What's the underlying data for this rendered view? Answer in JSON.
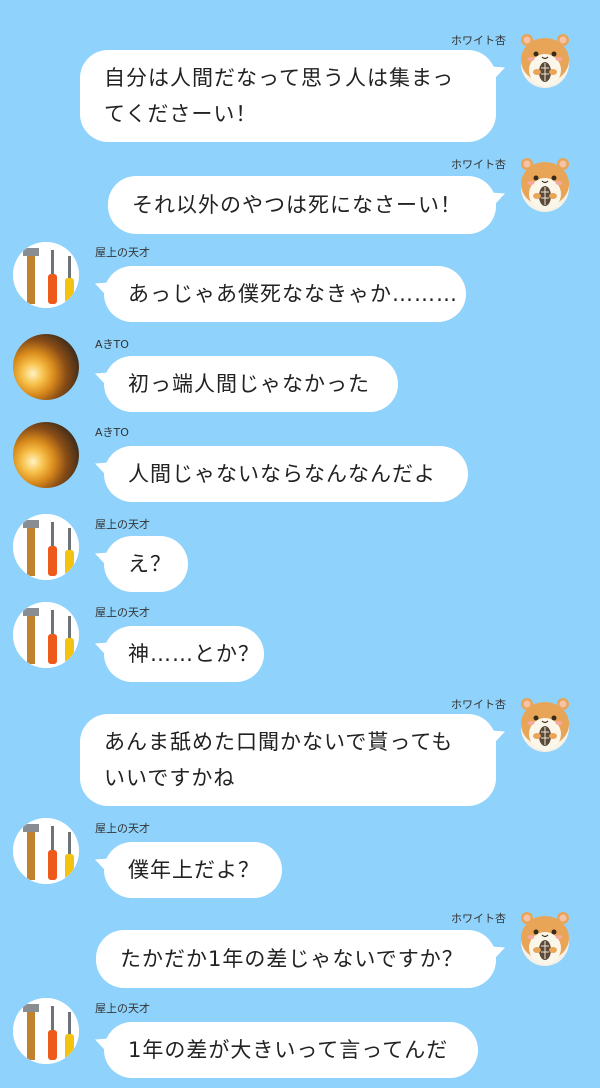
{
  "colors": {
    "background": "#8fd2fb",
    "bubble": "#ffffff",
    "text": "#222222"
  },
  "users": {
    "white_an": "ホワイト杏",
    "rooftop_genius": "屋上の天才",
    "akito": "AきTO"
  },
  "messages": [
    {
      "sender": "ホワイト杏",
      "side": "right",
      "avatar": "hamster-icon",
      "text": [
        "自分は人間だなって思う人は集まっ",
        "てくださーい！"
      ]
    },
    {
      "sender": "ホワイト杏",
      "side": "right",
      "avatar": "hamster-icon",
      "text": [
        "それ以外のやつは死になさーい！"
      ]
    },
    {
      "sender": "屋上の天才",
      "side": "left",
      "avatar": "tools-icon",
      "text": [
        "あっじゃあ僕死ななきゃか………"
      ]
    },
    {
      "sender": "AきTO",
      "side": "left",
      "avatar": "fire-photo-avatar",
      "text": [
        "初っ端人間じゃなかった"
      ]
    },
    {
      "sender": "AきTO",
      "side": "left",
      "avatar": "fire-photo-avatar",
      "text": [
        "人間じゃないならなんなんだよ"
      ]
    },
    {
      "sender": "屋上の天才",
      "side": "left",
      "avatar": "tools-icon",
      "text": [
        "え？"
      ]
    },
    {
      "sender": "屋上の天才",
      "side": "left",
      "avatar": "tools-icon",
      "text": [
        "神……とか？"
      ]
    },
    {
      "sender": "ホワイト杏",
      "side": "right",
      "avatar": "hamster-icon",
      "text": [
        "あんま舐めた口聞かないで貰っても",
        "いいですかね"
      ]
    },
    {
      "sender": "屋上の天才",
      "side": "left",
      "avatar": "tools-icon",
      "text": [
        "僕年上だよ？"
      ]
    },
    {
      "sender": "ホワイト杏",
      "side": "right",
      "avatar": "hamster-icon",
      "text": [
        "たかだか1年の差じゃないですか？"
      ]
    },
    {
      "sender": "屋上の天才",
      "side": "left",
      "avatar": "tools-icon",
      "text": [
        "1年の差が大きいって言ってんだ"
      ]
    }
  ]
}
